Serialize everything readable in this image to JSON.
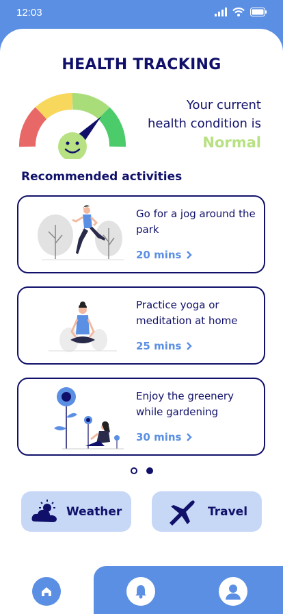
{
  "status": {
    "time": "12:03",
    "icons": [
      "signal-icon",
      "wifi-icon",
      "battery-icon"
    ]
  },
  "header": {
    "title": "HEALTH TRACKING"
  },
  "health": {
    "line1": "Your current",
    "line2": "health condition is",
    "status": "Normal",
    "status_color": "#b7e182"
  },
  "recommended": {
    "title": "Recommended activities",
    "items": [
      {
        "text": "Go for a jog around the park",
        "duration": "20 mins",
        "illustration": "jogging-illustration"
      },
      {
        "text": "Practice yoga or meditation at home",
        "duration": "25 mins",
        "illustration": "yoga-illustration"
      },
      {
        "text": "Enjoy the greenery while gardening",
        "duration": "30 mins",
        "illustration": "gardening-illustration"
      }
    ]
  },
  "pager": {
    "pages": 2,
    "current": 2
  },
  "quick_actions": [
    {
      "label": "Weather",
      "icon": "weather-icon"
    },
    {
      "label": "Travel",
      "icon": "airplane-icon"
    }
  ],
  "nav": [
    {
      "icon": "home-icon",
      "active": true
    },
    {
      "icon": "bell-icon",
      "active": false
    },
    {
      "icon": "profile-icon",
      "active": false
    }
  ],
  "colors": {
    "navy": "#10106a",
    "accent": "#5b8fe3",
    "light_accent": "#c7d8f7"
  }
}
